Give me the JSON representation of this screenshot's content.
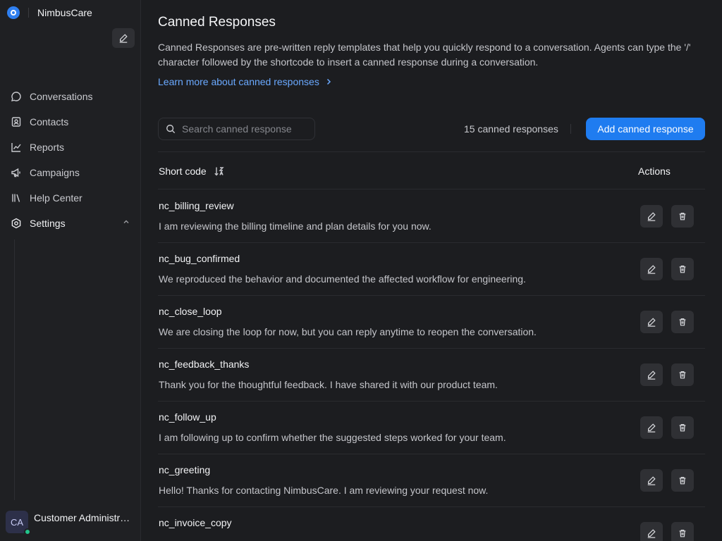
{
  "app": {
    "name": "NimbusCare"
  },
  "sidebar": {
    "items": [
      {
        "label": "Conversations",
        "icon": "chat-bubble-icon"
      },
      {
        "label": "Contacts",
        "icon": "contact-card-icon"
      },
      {
        "label": "Reports",
        "icon": "line-chart-icon"
      },
      {
        "label": "Campaigns",
        "icon": "megaphone-icon"
      },
      {
        "label": "Help Center",
        "icon": "library-icon"
      },
      {
        "label": "Settings",
        "icon": "gear-icon",
        "expanded": true
      }
    ],
    "profile": {
      "initials": "CA",
      "name": "Customer Administrator",
      "status": "online"
    }
  },
  "page": {
    "title": "Canned Responses",
    "description": "Canned Responses are pre-written reply templates that help you quickly respond to a conversation. Agents can type the '/' character followed by the shortcode to insert a canned response during a conversation.",
    "learn_more": "Learn more about canned responses",
    "search_placeholder": "Search canned response",
    "count": "15 canned responses",
    "add_button": "Add canned response"
  },
  "table": {
    "columns": {
      "short_code": "Short code",
      "actions": "Actions"
    },
    "rows": [
      {
        "code": "nc_billing_review",
        "text": "I am reviewing the billing timeline and plan details for you now."
      },
      {
        "code": "nc_bug_confirmed",
        "text": "We reproduced the behavior and documented the affected workflow for engineering."
      },
      {
        "code": "nc_close_loop",
        "text": "We are closing the loop for now, but you can reply anytime to reopen the conversation."
      },
      {
        "code": "nc_feedback_thanks",
        "text": "Thank you for the thoughtful feedback. I have shared it with our product team."
      },
      {
        "code": "nc_follow_up",
        "text": "I am following up to confirm whether the suggested steps worked for your team."
      },
      {
        "code": "nc_greeting",
        "text": "Hello! Thanks for contacting NimbusCare. I am reviewing your request now."
      },
      {
        "code": "nc_invoice_copy",
        "text": ""
      }
    ]
  },
  "colors": {
    "accent": "#1f7cf0",
    "link": "#6aa9ff",
    "online": "#22c58b"
  }
}
